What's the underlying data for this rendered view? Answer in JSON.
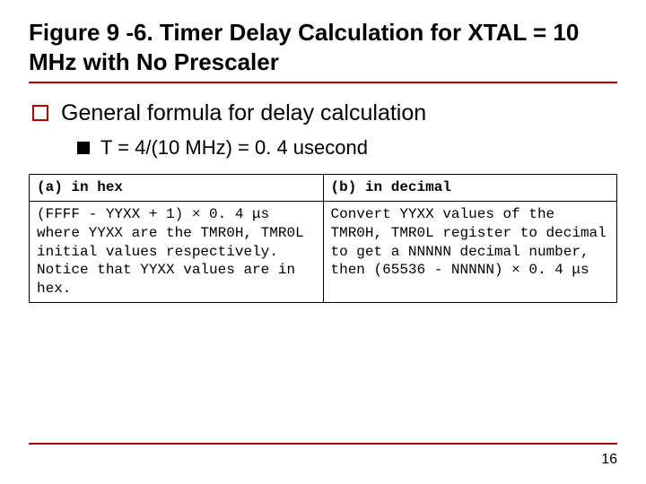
{
  "title": "Figure 9 -6. Timer Delay Calculation for XTAL = 10 MHz with No Prescaler",
  "bullets": {
    "level1": "General formula for delay calculation",
    "level2": "T = 4/(10 MHz) = 0. 4 usecond"
  },
  "table": {
    "left_header": "(a) in hex",
    "right_header": "(b) in decimal",
    "left_body": "(FFFF - YYXX + 1) × 0. 4 μs where YYXX are the TMR0H, TMR0L initial values respectively. Notice that YYXX values are in hex.",
    "right_body": "Convert YYXX values of the TMR0H, TMR0L register to decimal to get a NNNNN decimal number, then (65536 - NNNNN) × 0. 4 μs"
  },
  "page_number": "16"
}
